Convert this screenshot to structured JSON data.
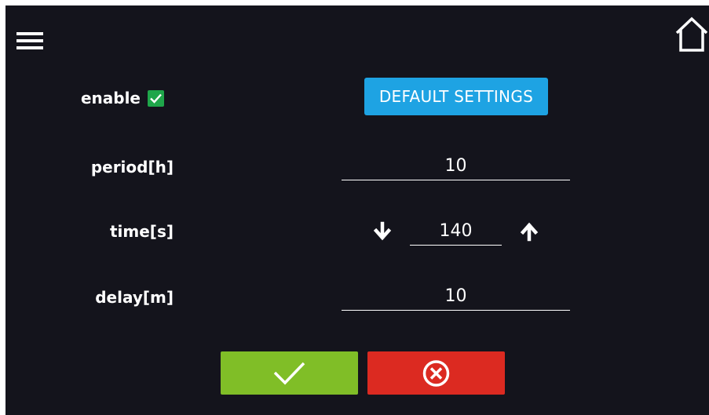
{
  "header": {
    "menu_icon": "hamburger-menu-icon",
    "home_icon": "home-icon"
  },
  "enable": {
    "label": "enable",
    "checked": true
  },
  "default_settings": {
    "label": "DEFAULT SETTINGS"
  },
  "period": {
    "label": "period[h]",
    "value": "10"
  },
  "time": {
    "label": "time[s]",
    "value": "140",
    "decrease_icon": "arrow-down-icon",
    "increase_icon": "arrow-up-icon"
  },
  "delay": {
    "label": "delay[m]",
    "value": "10"
  },
  "actions": {
    "confirm_icon": "checkmark-icon",
    "cancel_icon": "cancel-circle-x-icon"
  },
  "colors": {
    "background": "#14141c",
    "accent_blue": "#1ea3e3",
    "confirm_green": "#80be27",
    "cancel_red": "#dc2a21",
    "checkbox_green": "#1fa64a"
  }
}
